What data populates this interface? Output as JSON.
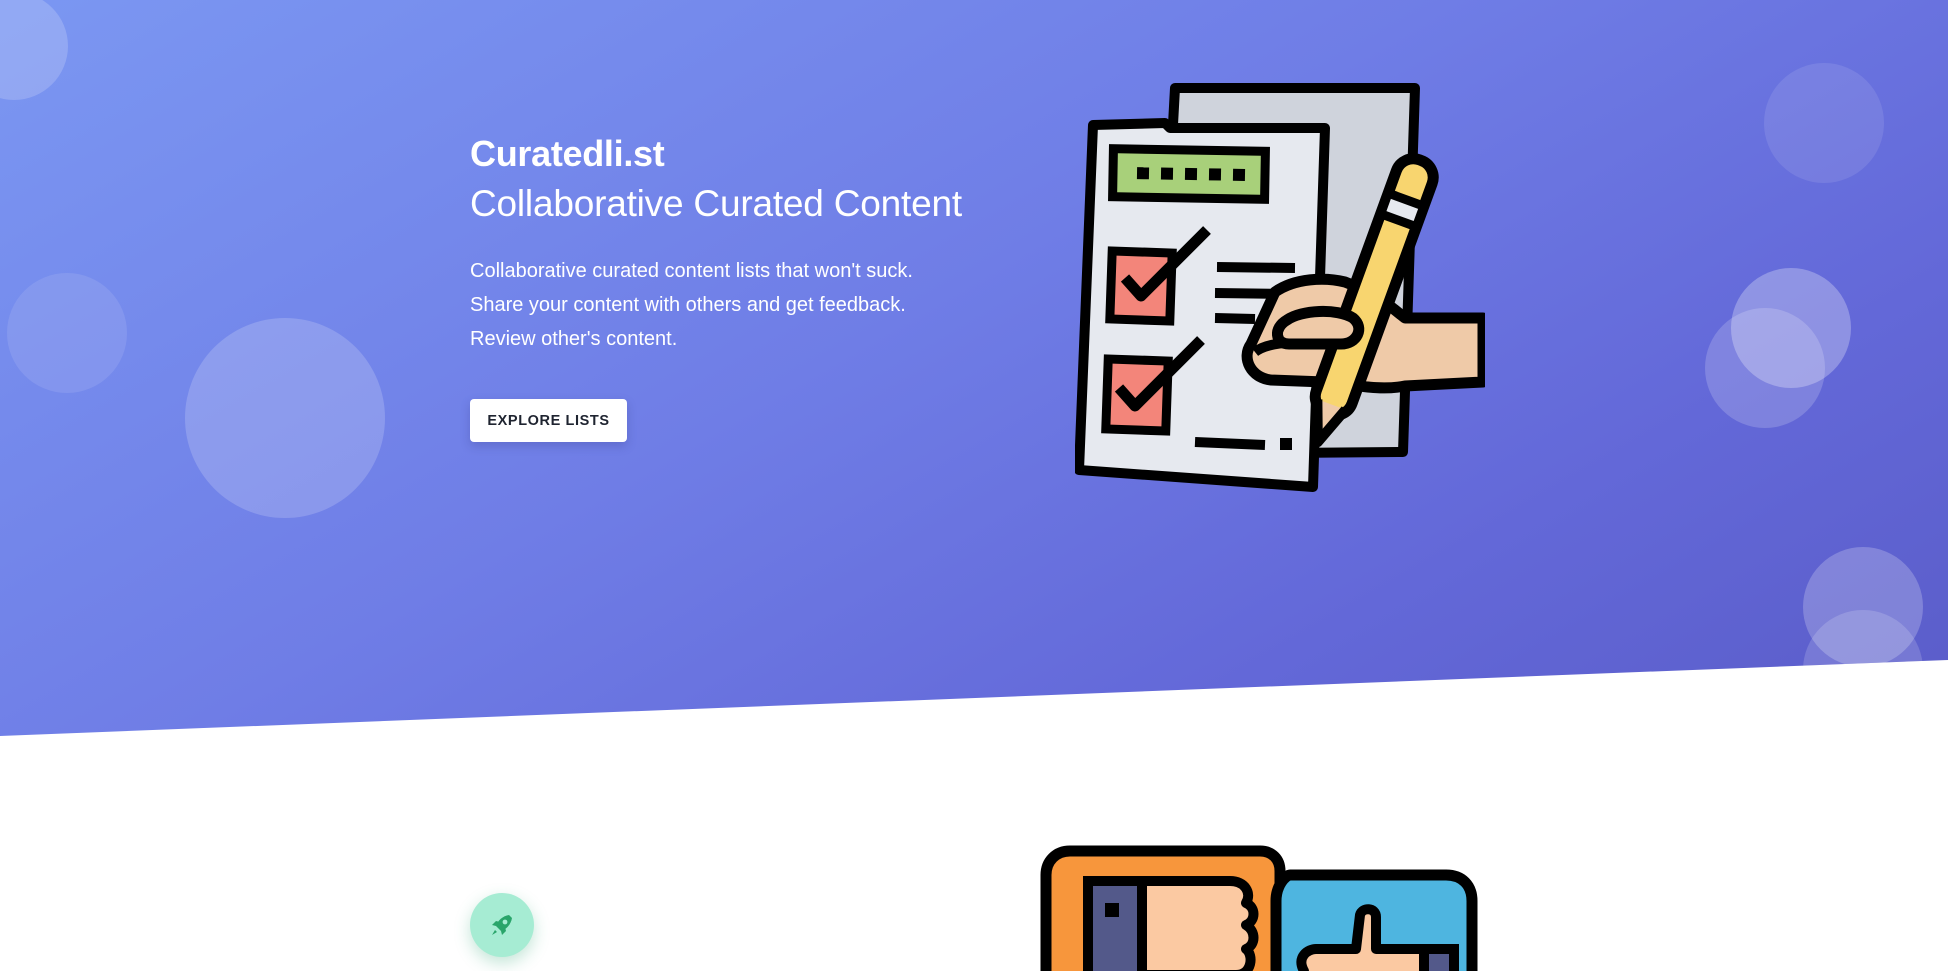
{
  "hero": {
    "brand": "Curatedli.st",
    "tagline": "Collaborative Curated Content",
    "description": [
      "Collaborative curated content lists that won't suck.",
      "Share your content with others and get feedback.",
      "Review other's content."
    ],
    "cta_label": "EXPLORE LISTS"
  },
  "illustrations": {
    "hero_image": "checklist-with-hand-and-pencil",
    "feature_image": "thumbs-down-and-thumbs-up"
  },
  "feature": {
    "icon": "rocket-icon"
  },
  "colors": {
    "hero_gradient_start": "#7b97f2",
    "hero_gradient_end": "#5a5cc8",
    "button_bg": "#ffffff",
    "button_text": "#1f2430",
    "feature_icon_bg": "#a6ecd3",
    "feature_icon_fg": "#2aa56b"
  }
}
